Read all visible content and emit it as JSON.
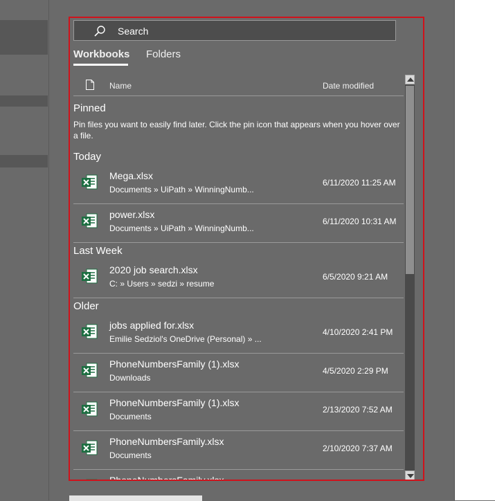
{
  "search": {
    "placeholder": "Search"
  },
  "tabs": [
    {
      "label": "Workbooks",
      "active": true
    },
    {
      "label": "Folders",
      "active": false
    }
  ],
  "columns": {
    "name": "Name",
    "date": "Date modified"
  },
  "sections": {
    "pinned": "Pinned",
    "pinned_message": "Pin files you want to easily find later. Click the pin icon that appears when you hover over a file.",
    "today": "Today",
    "last_week": "Last Week",
    "older": "Older"
  },
  "files": [
    {
      "name": "Mega.xlsx",
      "path": "Documents » UiPath » WinningNumb...",
      "date": "6/11/2020 11:25 AM"
    },
    {
      "name": "power.xlsx",
      "path": "Documents » UiPath » WinningNumb...",
      "date": "6/11/2020 10:31 AM"
    },
    {
      "name": "2020 job search.xlsx",
      "path": "C: » Users » sedzi » resume",
      "date": "6/5/2020 9:21 AM"
    },
    {
      "name": "jobs applied for.xlsx",
      "path": "Emilie Sedziol's OneDrive (Personal) » ...",
      "date": "4/10/2020 2:41 PM"
    },
    {
      "name": "PhoneNumbersFamily (1).xlsx",
      "path": "Downloads",
      "date": "4/5/2020 2:29 PM"
    },
    {
      "name": "PhoneNumbersFamily (1).xlsx",
      "path": "Documents",
      "date": "2/13/2020 7:52 AM"
    },
    {
      "name": "PhoneNumbersFamily.xlsx",
      "path": "Documents",
      "date": "2/10/2020 7:37 AM"
    },
    {
      "name": "PhoneNumbersFamily.xlsx",
      "path": "",
      "date": ""
    }
  ],
  "icons": {
    "search": "search-icon",
    "file": "file-icon",
    "excel": "excel-icon"
  },
  "colors": {
    "highlight_border": "#d0121b",
    "excel_green": "#1d6f42",
    "background": "#6a6a6a"
  }
}
